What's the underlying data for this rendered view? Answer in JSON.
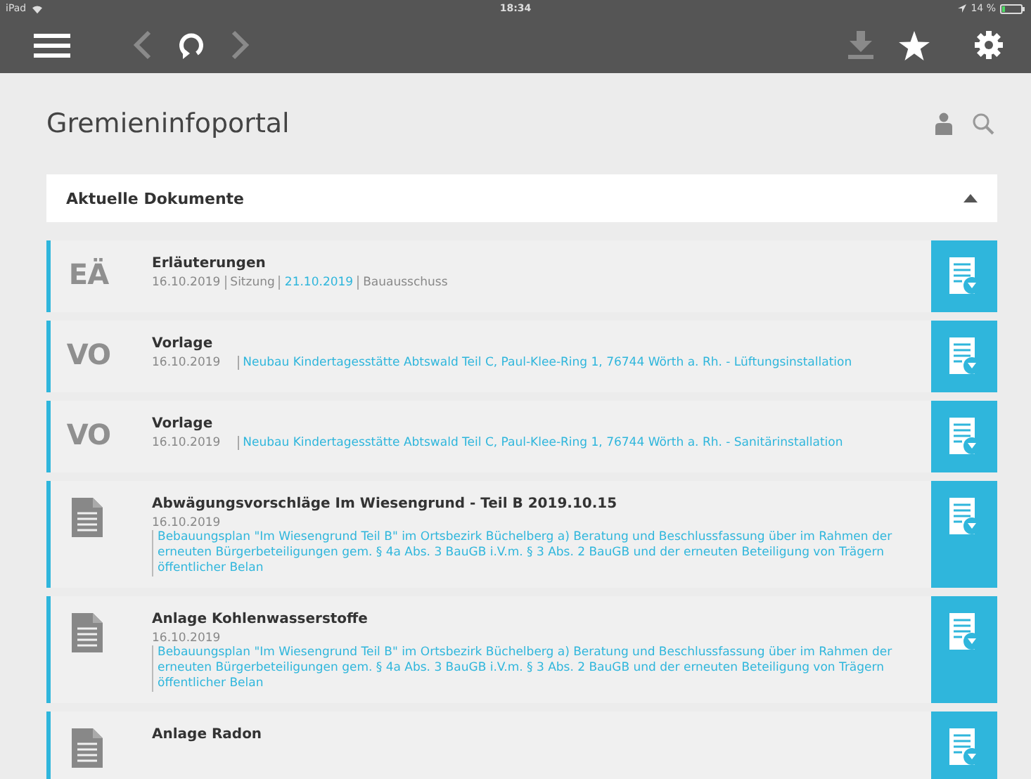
{
  "status_bar": {
    "device": "iPad",
    "time": "18:34",
    "battery": "14 %"
  },
  "toolbar": [
    {
      "kind": "menu",
      "disabled": false
    },
    {
      "kind": "back",
      "disabled": true
    },
    {
      "kind": "refresh",
      "disabled": false
    },
    {
      "kind": "forward",
      "disabled": true
    },
    {
      "kind": "spacer"
    },
    {
      "kind": "download",
      "disabled": true
    },
    {
      "kind": "star",
      "disabled": false
    },
    {
      "kind": "settings",
      "disabled": false
    }
  ],
  "page": {
    "title": "Gremieninfoportal"
  },
  "panel": {
    "title": "Aktuelle Dokumente",
    "expanded": true
  },
  "documents": [
    {
      "kind": "abbr",
      "abbr": "EÄ",
      "title": "Erläuterungen",
      "meta": [
        {
          "text": "16.10.2019",
          "link": false
        },
        {
          "text": "Sitzung",
          "link": false
        },
        {
          "text": "21.10.2019",
          "link": true
        },
        {
          "text": "Bauausschuss",
          "link": false
        }
      ]
    },
    {
      "kind": "abbr",
      "abbr": "VO",
      "title": "Vorlage",
      "meta": [
        {
          "text": "16.10.2019",
          "link": false
        },
        {
          "text": "Neubau Kindertagesstätte Abtswald Teil C, Paul-Klee-Ring 1, 76744 Wörth a. Rh. - Lüftungsinstallation",
          "link": true
        }
      ]
    },
    {
      "kind": "abbr",
      "abbr": "VO",
      "title": "Vorlage",
      "meta": [
        {
          "text": "16.10.2019",
          "link": false
        },
        {
          "text": "Neubau Kindertagesstätte Abtswald Teil C, Paul-Klee-Ring 1, 76744 Wörth a. Rh. - Sanitärinstallation",
          "link": true
        }
      ]
    },
    {
      "kind": "file",
      "title": "Abwägungsvorschläge Im Wiesengrund - Teil B 2019.10.15",
      "date": "16.10.2019",
      "description": "Bebauungsplan \"Im Wiesengrund Teil B\" im Ortsbezirk Büchelberg a) Beratung und Beschlussfassung über im Rahmen der erneuten Bürgerbeteiligungen gem. § 4a Abs. 3 BauGB i.V.m. § 3 Abs. 2 BauGB und der erneuten Beteiligung von Trägern öffentlicher Belan"
    },
    {
      "kind": "file",
      "title": "Anlage Kohlenwasserstoffe",
      "date": "16.10.2019",
      "description": "Bebauungsplan \"Im Wiesengrund Teil B\" im Ortsbezirk Büchelberg a) Beratung und Beschlussfassung über im Rahmen der erneuten Bürgerbeteiligungen gem. § 4a Abs. 3 BauGB i.V.m. § 3 Abs. 2 BauGB und der erneuten Beteiligung von Trägern öffentlicher Belan"
    },
    {
      "kind": "file",
      "title": "Anlage Radon"
    }
  ]
}
